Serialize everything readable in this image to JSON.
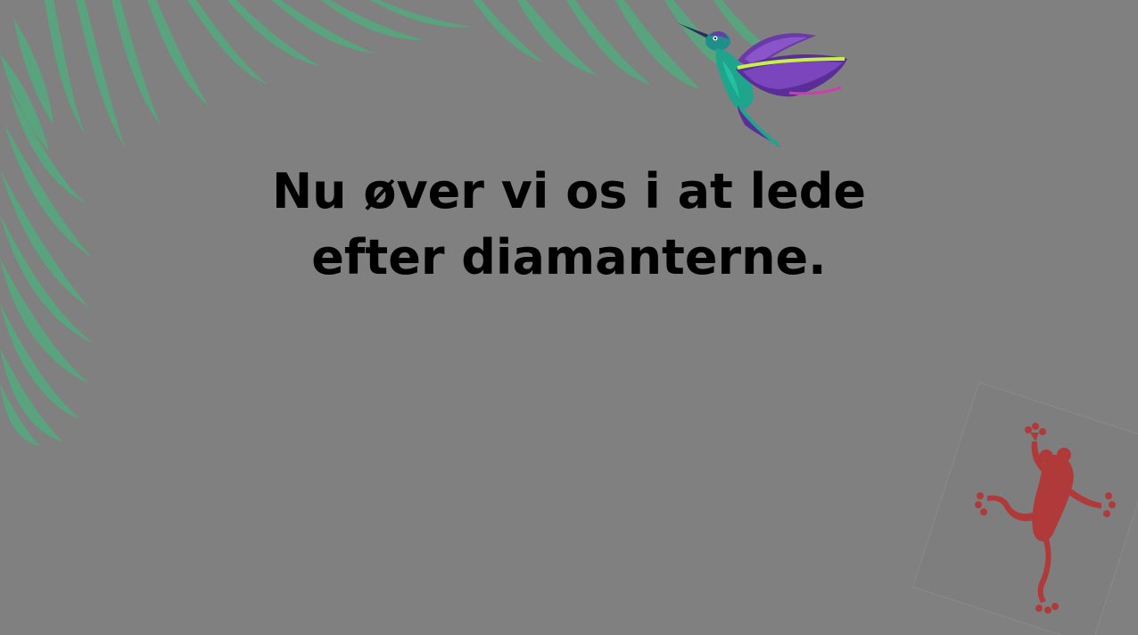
{
  "scene": {
    "message_line_1": "Nu øver vi os i at lede",
    "message_line_2": "efter diamanterne."
  },
  "colors": {
    "background": "#808080",
    "palm_leaf": "#4fae7e",
    "text": "#000000",
    "frog": "#b03a3a",
    "bird_body": "#1fa58e",
    "bird_wing": "#6a3aa8",
    "bird_accent": "#c8f04a"
  },
  "decorations": {
    "top_left": "palm-leaves",
    "top_right": "hummingbird",
    "bottom_right": "red-frog"
  }
}
